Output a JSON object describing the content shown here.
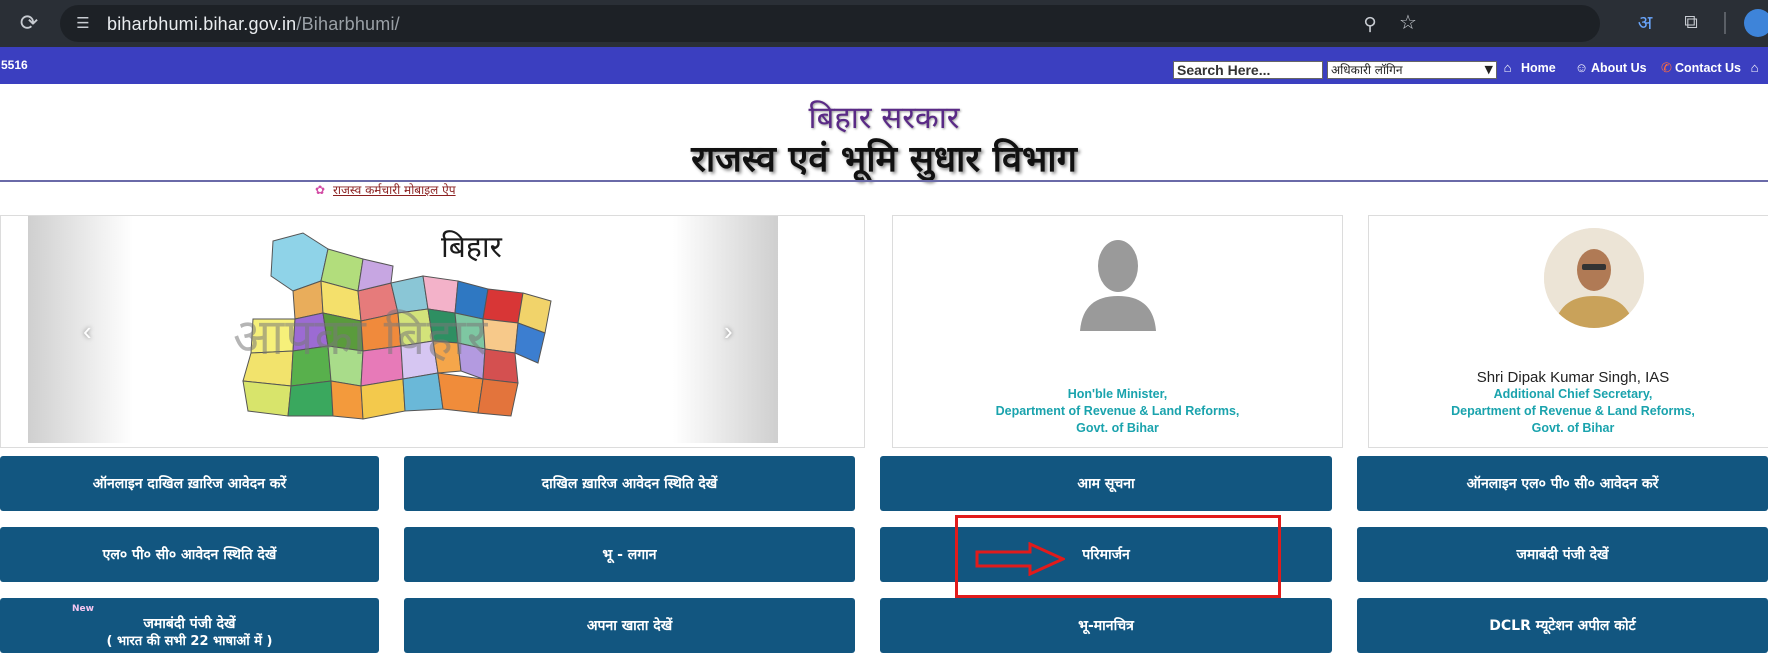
{
  "browser": {
    "url_domain": "biharbhumi.bihar.gov.in",
    "url_path": "/Biharbhumi/",
    "translate_glyph": "अ"
  },
  "navbar": {
    "counter": "5516",
    "search_placeholder": "Search Here...",
    "login_select": "अधिकारी लॉगिन",
    "home": "Home",
    "about": "About Us",
    "contact": "Contact Us"
  },
  "header": {
    "gov_title": "बिहार सरकार",
    "dept_title": "राजस्व एवं भूमि सुधार विभाग",
    "mobile_app_link": "राजस्व कर्मचारी मोबाइल ऐप"
  },
  "slider": {
    "map_title": "बिहार",
    "watermark": "आपका बिहार"
  },
  "minister": {
    "caption_line1": "Hon'ble Minister,",
    "caption_line2": "Department of Revenue & Land Reforms,",
    "caption_line3": "Govt. of Bihar"
  },
  "secretary": {
    "name": "Shri Dipak Kumar Singh, IAS",
    "caption_line1": "Additional Chief Secretary,",
    "caption_line2": "Department of Revenue & Land Reforms,",
    "caption_line3": "Govt. of Bihar"
  },
  "services": {
    "r1c1": "ऑनलाइन दाखिल ख़ारिज आवेदन करें",
    "r1c2": "दाखिल ख़ारिज आवेदन स्थिति देखें",
    "r1c3": "आम सूचना",
    "r1c4": "ऑनलाइन एल० पी० सी० आवेदन करें",
    "r2c1": "एल० पी० सी० आवेदन स्थिति देखें",
    "r2c2": "भू - लगान",
    "r2c3": "परिमार्जन",
    "r2c4": "जमाबंदी पंजी देखें",
    "r3c1_line1": "जमाबंदी पंजी देखें",
    "r3c1_line2": "( भारत की सभी 22 भाषाओं में )",
    "r3c1_badge": "New",
    "r3c2": "अपना खाता देखें",
    "r3c3": "भू-मानचित्र",
    "r3c4": "DCLR म्यूटेशन अपील कोर्ट"
  },
  "colors": {
    "navbar": "#3b3fc0",
    "button": "#125680",
    "caption": "#1aa3ad",
    "annotation": "#e11b1b"
  }
}
